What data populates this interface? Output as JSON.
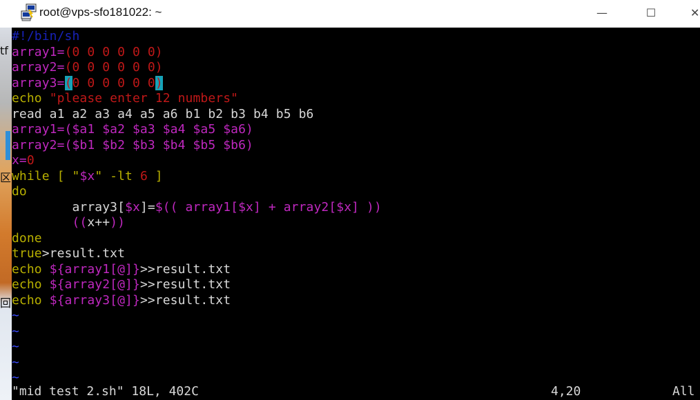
{
  "window": {
    "title": "root@vps-sfo181022: ~",
    "icon": "putty-icon",
    "minimize_glyph": "—",
    "maximize_glyph": "☐",
    "close_glyph": "✕"
  },
  "desktop_fragments": [
    {
      "text": "tf",
      "name": "desktop-label-fragment"
    },
    {
      "text": "区",
      "name": "desktop-label-fragment"
    },
    {
      "text": "回",
      "name": "desktop-label-fragment"
    }
  ],
  "colors": {
    "comment": "#1822b8",
    "variable": "#bf28bf",
    "number": "#c01818",
    "keyword": "#b8b000",
    "string": "#c01818",
    "text": "#d8d8d8",
    "cursor_bg": "#16a3b8",
    "tilde": "#3b4cff"
  },
  "editor_lines": [
    [
      {
        "t": "#!/bin/sh",
        "c": "comment"
      }
    ],
    [
      {
        "t": "array1=",
        "c": "variable"
      },
      {
        "t": "(0 0 0 0 0 0)",
        "c": "number"
      }
    ],
    [
      {
        "t": "array2=",
        "c": "variable"
      },
      {
        "t": "(0 0 0 0 0 0)",
        "c": "number"
      }
    ],
    [
      {
        "t": "array3=",
        "c": "variable"
      },
      {
        "t": "(",
        "c": "number",
        "hl": true
      },
      {
        "t": "0 0 0 0 0 0",
        "c": "number"
      },
      {
        "t": ")",
        "c": "number",
        "hl": true
      }
    ],
    [
      {
        "t": "echo ",
        "c": "keyword"
      },
      {
        "t": "\"please enter 12 numbers\"",
        "c": "string"
      }
    ],
    [
      {
        "t": "read a1 a2 a3 a4 a5 a6 b1 b2 b3 b4 b5 b6",
        "c": "text"
      }
    ],
    [
      {
        "t": "array1=($a1 $a2 $a3 $a4 $a5 $a6)",
        "c": "variable"
      }
    ],
    [
      {
        "t": "array2=($b1 $b2 $b3 $b4 $b5 $b6)",
        "c": "variable"
      }
    ],
    [
      {
        "t": "x=",
        "c": "variable"
      },
      {
        "t": "0",
        "c": "number"
      }
    ],
    [
      {
        "t": "while [ ",
        "c": "keyword"
      },
      {
        "t": "\"",
        "c": "keyword"
      },
      {
        "t": "$x",
        "c": "variable"
      },
      {
        "t": "\"",
        "c": "keyword"
      },
      {
        "t": " -lt ",
        "c": "keyword"
      },
      {
        "t": "6",
        "c": "number"
      },
      {
        "t": " ]",
        "c": "keyword"
      }
    ],
    [
      {
        "t": "do",
        "c": "keyword"
      }
    ],
    [
      {
        "t": "        array3[",
        "c": "text"
      },
      {
        "t": "$x",
        "c": "variable"
      },
      {
        "t": "]=",
        "c": "text"
      },
      {
        "t": "$(( array1[$x] + array2[$x] ))",
        "c": "variable"
      }
    ],
    [
      {
        "t": "        ",
        "c": "text"
      },
      {
        "t": "((",
        "c": "variable"
      },
      {
        "t": "x++",
        "c": "text"
      },
      {
        "t": "))",
        "c": "variable"
      }
    ],
    [
      {
        "t": "done",
        "c": "keyword"
      }
    ],
    [
      {
        "t": "true",
        "c": "keyword"
      },
      {
        "t": ">result.txt",
        "c": "text"
      }
    ],
    [
      {
        "t": "echo ",
        "c": "keyword"
      },
      {
        "t": "${array1[@]}",
        "c": "variable"
      },
      {
        "t": ">>result.txt",
        "c": "text"
      }
    ],
    [
      {
        "t": "echo ",
        "c": "keyword"
      },
      {
        "t": "${array2[@]}",
        "c": "variable"
      },
      {
        "t": ">>result.txt",
        "c": "text"
      }
    ],
    [
      {
        "t": "echo ",
        "c": "keyword"
      },
      {
        "t": "${array3[@]}",
        "c": "variable"
      },
      {
        "t": ">>result.txt",
        "c": "text"
      }
    ]
  ],
  "empty_lines": [
    "~",
    "~",
    "~",
    "~",
    "~"
  ],
  "status": {
    "file_info": "\"mid test 2.sh\" 18L, 402C",
    "cursor_position": "4,20",
    "scroll_position": "All"
  }
}
